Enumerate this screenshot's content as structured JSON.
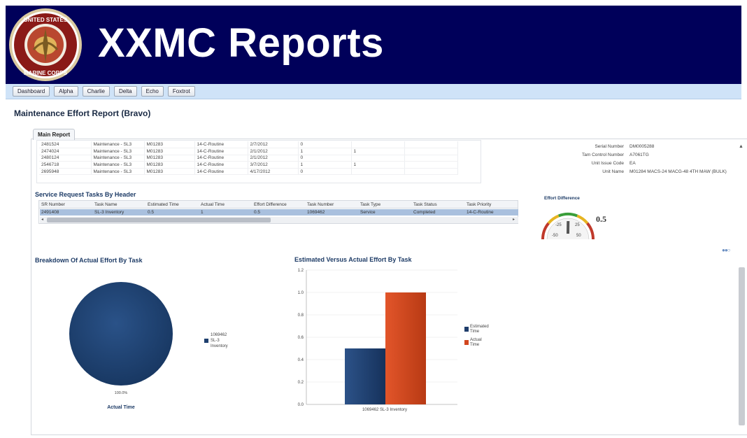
{
  "header": {
    "title": "XXMC Reports",
    "logo_text": "UNITED STATES MARINE CORPS"
  },
  "nav": {
    "items": [
      "Dashboard",
      "Alpha",
      "Charlie",
      "Delta",
      "Echo",
      "Foxtrot"
    ]
  },
  "page_title": "Maintenance Effort Report (Bravo)",
  "tab": {
    "label": "Main Report"
  },
  "top_table": {
    "rows": [
      [
        "2481524",
        "Maintenance - SL3",
        "M01283",
        "14-C-Routine",
        "2/7/2012",
        "0",
        ""
      ],
      [
        "2474024",
        "Maintenance - SL3",
        "M01283",
        "14-C-Routine",
        "2/1/2012",
        "1",
        "1"
      ],
      [
        "2480124",
        "Maintenance - SL3",
        "M01283",
        "14-C-Routine",
        "2/1/2012",
        "0",
        ""
      ],
      [
        "2546718",
        "Maintenance - SL3",
        "M01283",
        "14-C-Routine",
        "3/7/2012",
        "1",
        "1"
      ],
      [
        "2695948",
        "Maintenance - SL3",
        "M01283",
        "14-C-Routine",
        "4/17/2012",
        "0",
        ""
      ]
    ]
  },
  "details": [
    {
      "label": "Serial Number",
      "value": "DM0005288"
    },
    {
      "label": "Tam Control Number",
      "value": "A7061TG"
    },
    {
      "label": "Unit Issue Code",
      "value": "EA"
    },
    {
      "label": "Unit Name",
      "value": "M01284 MACS-24 MACG-48 4TH MAW (BULK)"
    }
  ],
  "tasks": {
    "heading": "Service Request Tasks By Header",
    "columns": [
      "SR Number",
      "Task Name",
      "Estimated Time",
      "Actual Time",
      "Effort Difference",
      "Task Number",
      "Task Type",
      "Task Status",
      "Task Priority"
    ],
    "row": [
      "2491408",
      "SL-3 Inventory",
      "0.5",
      "1",
      "0.5",
      "1069462",
      "Service",
      "Completed",
      "14-C-Routine"
    ]
  },
  "gauge": {
    "title": "Effort Difference",
    "value": 0.5,
    "value_text": "0.5",
    "ticks": [
      "-25",
      "25",
      "-50",
      "50"
    ],
    "min": -50,
    "max": 50,
    "colors": {
      "low": "#c0392b",
      "mid": "#e6b422",
      "high": "#3a9e3a"
    }
  },
  "pie_chart": {
    "title": "Breakdown Of Actual Effort By Task",
    "slice_label": "100.0%",
    "legend": [
      "1069462",
      "SL-3",
      "Inventory"
    ],
    "xlabel": "Actual Time",
    "color": "#1e3f6e"
  },
  "bar_chart": {
    "title": "Estimated Versus Actual Effort By Task",
    "legend": [
      {
        "lines": [
          "Estimated",
          "Time"
        ],
        "color": "#1f3d6b"
      },
      {
        "lines": [
          "Actual",
          "Time"
        ],
        "color": "#d2461f"
      }
    ],
    "category_label": "1069462 SL-3 Inventory",
    "yticks": [
      "0.0",
      "0.2",
      "0.4",
      "0.6",
      "0.8",
      "1.0",
      "1.2"
    ]
  },
  "chart_data": [
    {
      "type": "pie",
      "title": "Breakdown Of Actual Effort By Task",
      "categories": [
        "1069462 SL-3 Inventory"
      ],
      "values": [
        100.0
      ],
      "xlabel": "Actual Time"
    },
    {
      "type": "bar",
      "title": "Estimated Versus Actual Effort By Task",
      "categories": [
        "1069462 SL-3 Inventory"
      ],
      "series": [
        {
          "name": "Estimated Time",
          "values": [
            0.5
          ]
        },
        {
          "name": "Actual Time",
          "values": [
            1.0
          ]
        }
      ],
      "ylim": [
        0,
        1.2
      ],
      "grid": true,
      "legend": "right"
    }
  ]
}
